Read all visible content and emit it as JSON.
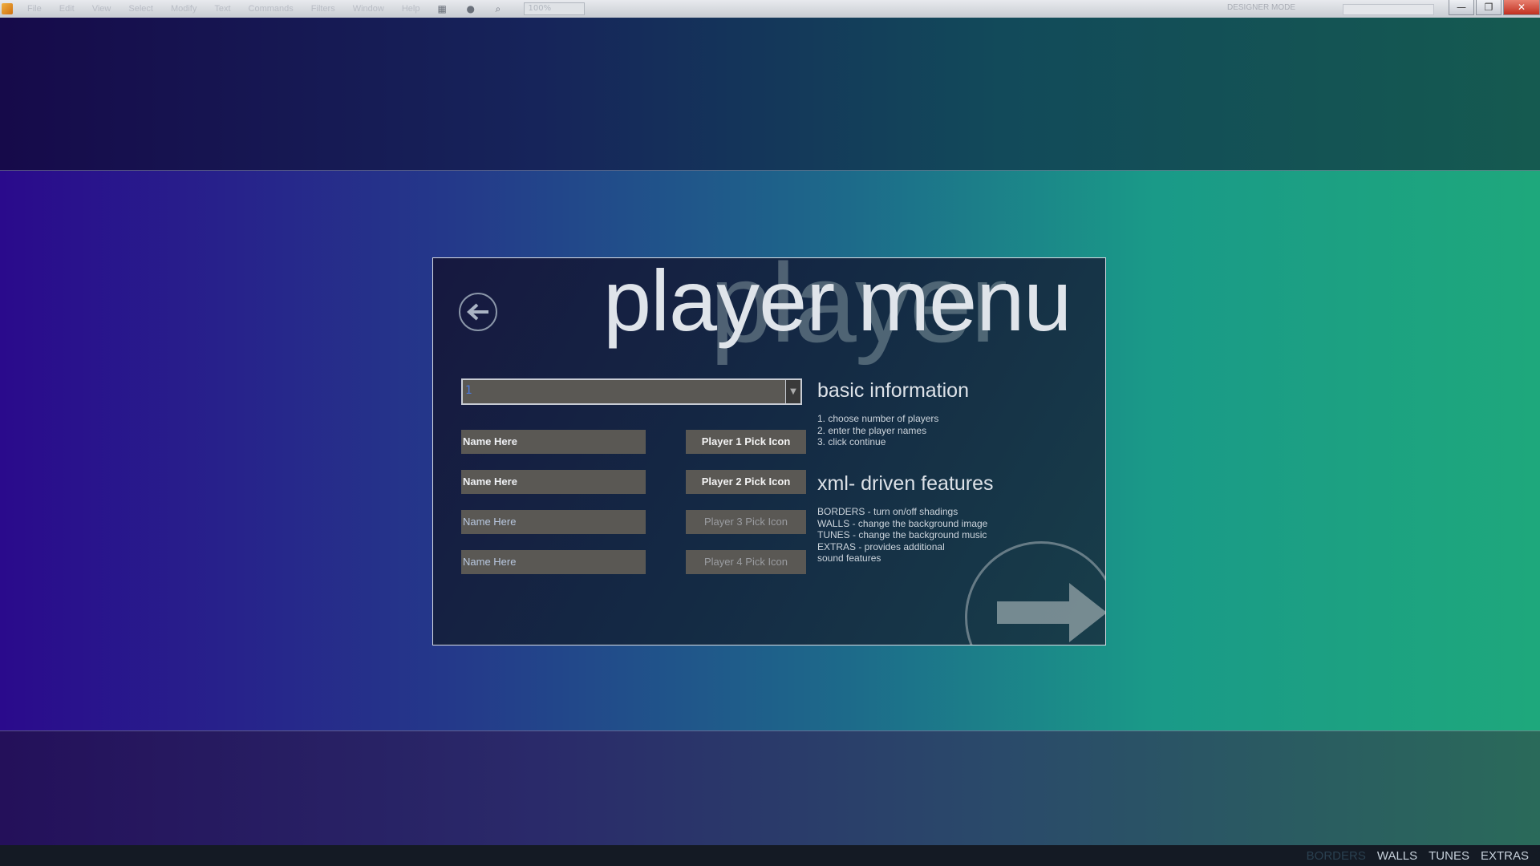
{
  "app": {
    "menu": [
      "File",
      "Edit",
      "View",
      "Select",
      "Modify",
      "Text",
      "Commands",
      "Filters",
      "Window",
      "Help"
    ],
    "zoom": "100%",
    "workspace": "DESIGNER MODE",
    "window_controls": {
      "minimize": "—",
      "restore": "❐",
      "close": "✕"
    }
  },
  "dialog": {
    "title": "player menu",
    "watermark": "player",
    "player_count_value": "1",
    "players": [
      {
        "name": "Name Here",
        "pick_label": "Player 1 Pick Icon",
        "enabled": true
      },
      {
        "name": "Name Here",
        "pick_label": "Player 2 Pick Icon",
        "enabled": true
      },
      {
        "name": "Name Here",
        "pick_label": "Player 3 Pick Icon",
        "enabled": false
      },
      {
        "name": "Name Here",
        "pick_label": "Player 4 Pick Icon",
        "enabled": false
      }
    ],
    "basic_info": {
      "heading": "basic information",
      "steps": [
        "1. choose number of players",
        "2. enter the player names",
        "3. click continue"
      ]
    },
    "xml_features": {
      "heading": "xml- driven features",
      "lines": [
        "BORDERS - turn on/off shadings",
        "WALLS - change the background image",
        "TUNES - change the background music",
        "EXTRAS - provides additional",
        "sound features"
      ]
    }
  },
  "footer_nav": [
    "BORDERS",
    "WALLS",
    "TUNES",
    "EXTRAS"
  ],
  "icons": {
    "back": "arrow-left-icon",
    "next": "arrow-right-icon"
  },
  "colors": {
    "field_bg": "#5a5854",
    "title": "#dfe4ea"
  }
}
